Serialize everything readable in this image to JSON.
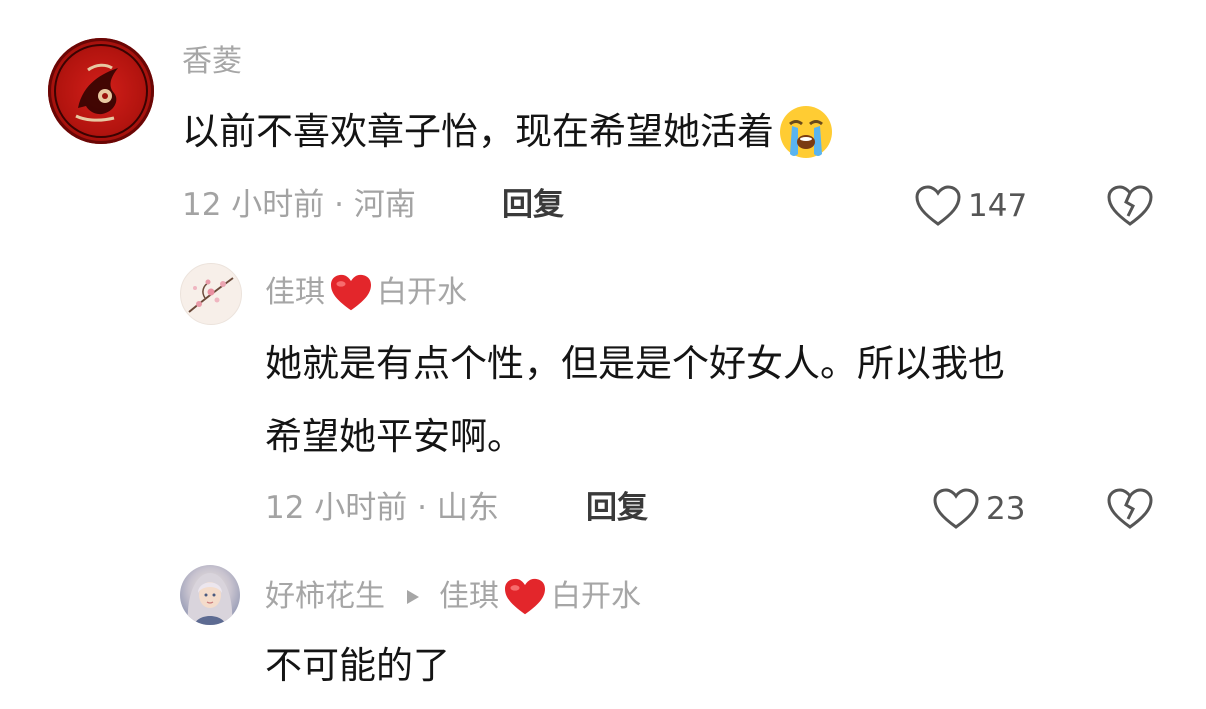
{
  "comment": {
    "author": "香菱",
    "text": "以前不喜欢章子怡，现在希望她活着",
    "emoji": "loudly-crying-face",
    "time_location": "12 小时前 · 河南",
    "reply_label": "回复",
    "likes": "147"
  },
  "reply1": {
    "author_part1": "佳琪",
    "author_part2": "白开水",
    "text_line1": "她就是有点个性，但是是个好女人。所以我也",
    "text_line2": "希望她平安啊。",
    "time_location": "12 小时前 · 山东",
    "reply_label": "回复",
    "likes": "23"
  },
  "reply2": {
    "author": "好柿花生",
    "reply_to_part1": "佳琪",
    "reply_to_part2": "白开水",
    "text": "不可能的了"
  },
  "colors": {
    "name_gray": "#a6a6a6",
    "heart_red": "#e3262b",
    "text_dark": "#141414"
  }
}
